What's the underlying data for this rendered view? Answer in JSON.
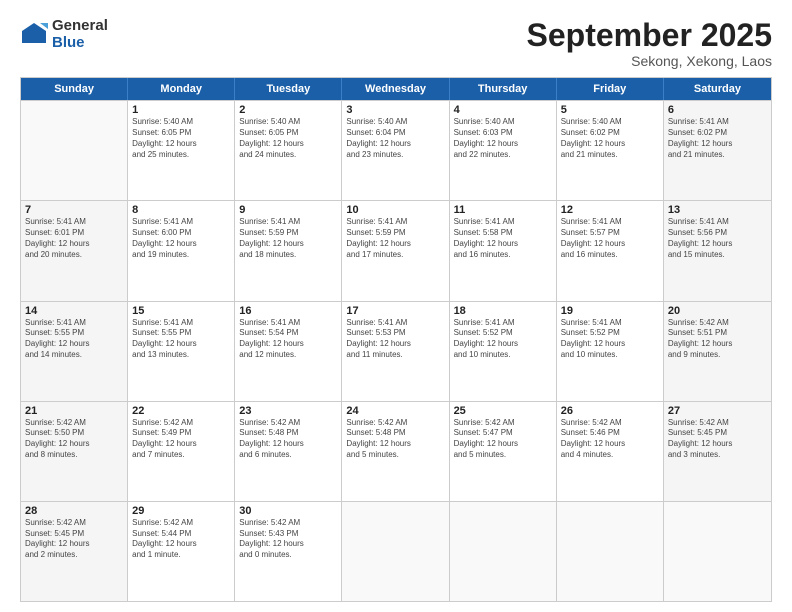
{
  "logo": {
    "general": "General",
    "blue": "Blue"
  },
  "header": {
    "month": "September 2025",
    "location": "Sekong, Xekong, Laos"
  },
  "weekdays": [
    "Sunday",
    "Monday",
    "Tuesday",
    "Wednesday",
    "Thursday",
    "Friday",
    "Saturday"
  ],
  "weeks": [
    [
      {
        "day": "",
        "info": "",
        "empty": true
      },
      {
        "day": "1",
        "info": "Sunrise: 5:40 AM\nSunset: 6:05 PM\nDaylight: 12 hours\nand 25 minutes.",
        "empty": false
      },
      {
        "day": "2",
        "info": "Sunrise: 5:40 AM\nSunset: 6:05 PM\nDaylight: 12 hours\nand 24 minutes.",
        "empty": false
      },
      {
        "day": "3",
        "info": "Sunrise: 5:40 AM\nSunset: 6:04 PM\nDaylight: 12 hours\nand 23 minutes.",
        "empty": false
      },
      {
        "day": "4",
        "info": "Sunrise: 5:40 AM\nSunset: 6:03 PM\nDaylight: 12 hours\nand 22 minutes.",
        "empty": false
      },
      {
        "day": "5",
        "info": "Sunrise: 5:40 AM\nSunset: 6:02 PM\nDaylight: 12 hours\nand 21 minutes.",
        "empty": false
      },
      {
        "day": "6",
        "info": "Sunrise: 5:41 AM\nSunset: 6:02 PM\nDaylight: 12 hours\nand 21 minutes.",
        "empty": false,
        "shaded": true
      }
    ],
    [
      {
        "day": "7",
        "info": "Sunrise: 5:41 AM\nSunset: 6:01 PM\nDaylight: 12 hours\nand 20 minutes.",
        "empty": false,
        "shaded": true
      },
      {
        "day": "8",
        "info": "Sunrise: 5:41 AM\nSunset: 6:00 PM\nDaylight: 12 hours\nand 19 minutes.",
        "empty": false
      },
      {
        "day": "9",
        "info": "Sunrise: 5:41 AM\nSunset: 5:59 PM\nDaylight: 12 hours\nand 18 minutes.",
        "empty": false
      },
      {
        "day": "10",
        "info": "Sunrise: 5:41 AM\nSunset: 5:59 PM\nDaylight: 12 hours\nand 17 minutes.",
        "empty": false
      },
      {
        "day": "11",
        "info": "Sunrise: 5:41 AM\nSunset: 5:58 PM\nDaylight: 12 hours\nand 16 minutes.",
        "empty": false
      },
      {
        "day": "12",
        "info": "Sunrise: 5:41 AM\nSunset: 5:57 PM\nDaylight: 12 hours\nand 16 minutes.",
        "empty": false
      },
      {
        "day": "13",
        "info": "Sunrise: 5:41 AM\nSunset: 5:56 PM\nDaylight: 12 hours\nand 15 minutes.",
        "empty": false,
        "shaded": true
      }
    ],
    [
      {
        "day": "14",
        "info": "Sunrise: 5:41 AM\nSunset: 5:55 PM\nDaylight: 12 hours\nand 14 minutes.",
        "empty": false,
        "shaded": true
      },
      {
        "day": "15",
        "info": "Sunrise: 5:41 AM\nSunset: 5:55 PM\nDaylight: 12 hours\nand 13 minutes.",
        "empty": false
      },
      {
        "day": "16",
        "info": "Sunrise: 5:41 AM\nSunset: 5:54 PM\nDaylight: 12 hours\nand 12 minutes.",
        "empty": false
      },
      {
        "day": "17",
        "info": "Sunrise: 5:41 AM\nSunset: 5:53 PM\nDaylight: 12 hours\nand 11 minutes.",
        "empty": false
      },
      {
        "day": "18",
        "info": "Sunrise: 5:41 AM\nSunset: 5:52 PM\nDaylight: 12 hours\nand 10 minutes.",
        "empty": false
      },
      {
        "day": "19",
        "info": "Sunrise: 5:41 AM\nSunset: 5:52 PM\nDaylight: 12 hours\nand 10 minutes.",
        "empty": false
      },
      {
        "day": "20",
        "info": "Sunrise: 5:42 AM\nSunset: 5:51 PM\nDaylight: 12 hours\nand 9 minutes.",
        "empty": false,
        "shaded": true
      }
    ],
    [
      {
        "day": "21",
        "info": "Sunrise: 5:42 AM\nSunset: 5:50 PM\nDaylight: 12 hours\nand 8 minutes.",
        "empty": false,
        "shaded": true
      },
      {
        "day": "22",
        "info": "Sunrise: 5:42 AM\nSunset: 5:49 PM\nDaylight: 12 hours\nand 7 minutes.",
        "empty": false
      },
      {
        "day": "23",
        "info": "Sunrise: 5:42 AM\nSunset: 5:48 PM\nDaylight: 12 hours\nand 6 minutes.",
        "empty": false
      },
      {
        "day": "24",
        "info": "Sunrise: 5:42 AM\nSunset: 5:48 PM\nDaylight: 12 hours\nand 5 minutes.",
        "empty": false
      },
      {
        "day": "25",
        "info": "Sunrise: 5:42 AM\nSunset: 5:47 PM\nDaylight: 12 hours\nand 5 minutes.",
        "empty": false
      },
      {
        "day": "26",
        "info": "Sunrise: 5:42 AM\nSunset: 5:46 PM\nDaylight: 12 hours\nand 4 minutes.",
        "empty": false
      },
      {
        "day": "27",
        "info": "Sunrise: 5:42 AM\nSunset: 5:45 PM\nDaylight: 12 hours\nand 3 minutes.",
        "empty": false,
        "shaded": true
      }
    ],
    [
      {
        "day": "28",
        "info": "Sunrise: 5:42 AM\nSunset: 5:45 PM\nDaylight: 12 hours\nand 2 minutes.",
        "empty": false,
        "shaded": true
      },
      {
        "day": "29",
        "info": "Sunrise: 5:42 AM\nSunset: 5:44 PM\nDaylight: 12 hours\nand 1 minute.",
        "empty": false
      },
      {
        "day": "30",
        "info": "Sunrise: 5:42 AM\nSunset: 5:43 PM\nDaylight: 12 hours\nand 0 minutes.",
        "empty": false
      },
      {
        "day": "",
        "info": "",
        "empty": true
      },
      {
        "day": "",
        "info": "",
        "empty": true
      },
      {
        "day": "",
        "info": "",
        "empty": true
      },
      {
        "day": "",
        "info": "",
        "empty": true
      }
    ]
  ]
}
